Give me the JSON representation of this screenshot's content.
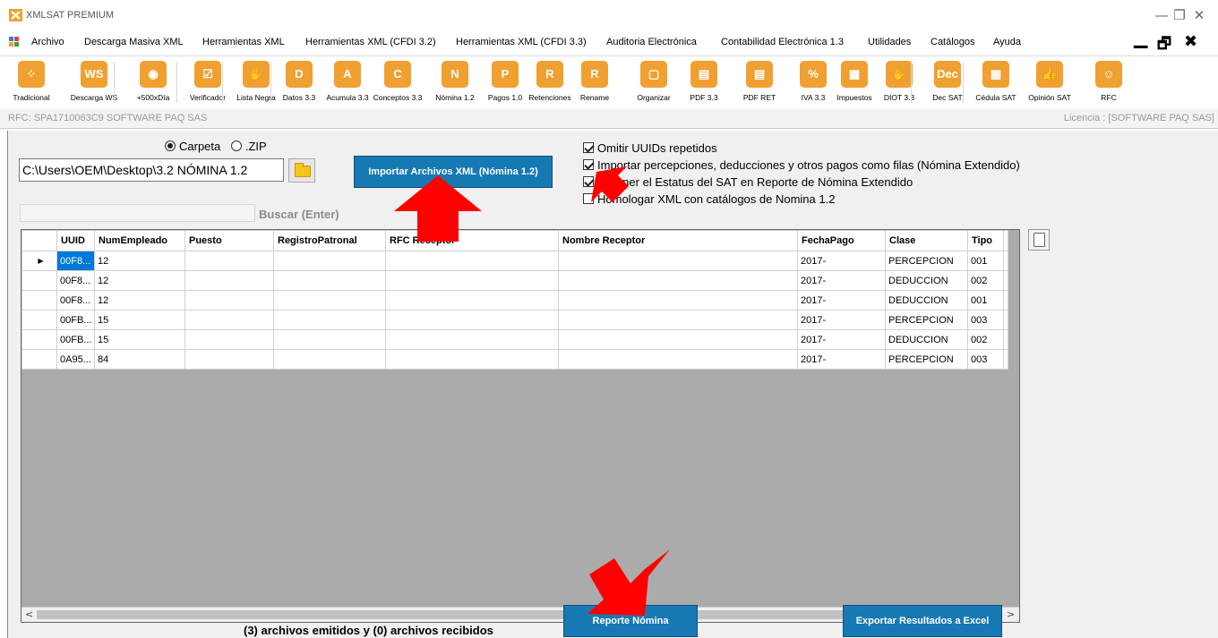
{
  "app": {
    "title": "XMLSAT PREMIUM"
  },
  "window_controls": {
    "minimize": "—",
    "maximize": "❐",
    "close": "✕"
  },
  "menu": {
    "items": [
      "Archivo",
      "Descarga Masiva XML",
      "Herramientas XML",
      "Herramientas XML (CFDI 3.2)",
      "Herramientas XML (CFDI 3.3)",
      "Auditoria Electrónica",
      "Contabilidad Electrónica 1.3",
      "Utilidades",
      "Catálogos",
      "Ayuda"
    ],
    "mdi_minimize": "▁",
    "mdi_restore": "🗗",
    "mdi_close": "✖"
  },
  "toolbar": {
    "tools": [
      {
        "label": "Tradicional",
        "icon": "⁘",
        "color": "#f0a030",
        "name": "tradicional"
      },
      {
        "label": "Descarga WS",
        "icon": "WS",
        "color": "#f0a030",
        "name": "descarga-ws"
      },
      {
        "label": "+500xDía",
        "icon": "◉",
        "color": "#f0a030",
        "name": "500xdia"
      },
      {
        "label": "Verificador",
        "icon": "☑",
        "color": "#f0a030",
        "name": "verificador"
      },
      {
        "label": "Lista Negra",
        "icon": "✋",
        "color": "#f0a030",
        "name": "lista-negra"
      },
      {
        "label": "Datos 3.3",
        "icon": "D",
        "color": "#f0a030",
        "name": "datos-33"
      },
      {
        "label": "Acumula 3.3",
        "icon": "A",
        "color": "#f0a030",
        "name": "acumula-33"
      },
      {
        "label": "Conceptos 3.3",
        "icon": "C",
        "color": "#f0a030",
        "name": "conceptos-33"
      },
      {
        "label": "Nómina 1.2",
        "icon": "N",
        "color": "#f0a030",
        "name": "nomina-12"
      },
      {
        "label": "Pagos 1.0",
        "icon": "P",
        "color": "#f0a030",
        "name": "pagos-10"
      },
      {
        "label": "Retenciones",
        "icon": "R",
        "color": "#f0a030",
        "name": "retenciones"
      },
      {
        "label": "Rename",
        "icon": "R",
        "color": "#f0a030",
        "name": "rename"
      },
      {
        "label": "Organizar",
        "icon": "▢",
        "color": "#f0a030",
        "name": "organizar"
      },
      {
        "label": "PDF 3.3",
        "icon": "▤",
        "color": "#f0a030",
        "name": "pdf-33"
      },
      {
        "label": "PDF RET",
        "icon": "▤",
        "color": "#f0a030",
        "name": "pdf-ret"
      },
      {
        "label": "IVA 3.3",
        "icon": "%",
        "color": "#f0a030",
        "name": "iva-33"
      },
      {
        "label": "Impuestos",
        "icon": "▦",
        "color": "#f0a030",
        "name": "impuestos"
      },
      {
        "label": "DIOT 3.3",
        "icon": "✋",
        "color": "#f0a030",
        "name": "diot-33"
      },
      {
        "label": "Dec SAT",
        "icon": "Dec",
        "color": "#f0a030",
        "name": "dec-sat"
      },
      {
        "label": "Cédula SAT",
        "icon": "▦",
        "color": "#f0a030",
        "name": "cedula-sat"
      },
      {
        "label": "Opinión SAT",
        "icon": "👍",
        "color": "#f0a030",
        "name": "opinion-sat"
      },
      {
        "label": "RFC",
        "icon": "☺",
        "color": "#f0a030",
        "name": "rfc"
      }
    ]
  },
  "rfc_bar": {
    "rfc": "RFC: SPA1710063C9 SOFTWARE PAQ SAS",
    "license": "Licencia : [SOFTWARE PAQ SAS]"
  },
  "source": {
    "option_folder": "Carpeta",
    "option_zip": ".ZIP",
    "selected": "Carpeta"
  },
  "path": {
    "value": "C:\\Users\\OEM\\Desktop\\3.2 NÓMINA 1.2"
  },
  "import_button": "Importar Archivos  XML (Nómina 1.2)",
  "options": [
    {
      "label": "Omitir UUIDs repetidos",
      "checked": true
    },
    {
      "label": "Importar percepciones, deducciones y otros pagos como filas (Nómina Extendido)",
      "checked": true
    },
    {
      "label": "Obtener el Estatus del SAT en Reporte de Nómina Extendido",
      "checked": true
    },
    {
      "label": "Homologar XML con catálogos de Nomina 1.2",
      "checked": false
    }
  ],
  "search": {
    "value": "",
    "label": "Buscar (Enter)"
  },
  "grid": {
    "columns": [
      "UUID",
      "NumEmpleado",
      "Puesto",
      "RegistroPatronal",
      "RFC Receptor",
      "Nombre Receptor",
      "FechaPago",
      "Clase",
      "Tipo"
    ],
    "rows": [
      [
        "00F8...",
        "12",
        "",
        "",
        "",
        "",
        "2017-",
        "PERCEPCION",
        "001"
      ],
      [
        "00F8...",
        "12",
        "",
        "",
        "",
        "",
        "2017-",
        "DEDUCCION",
        "002"
      ],
      [
        "00F8...",
        "12",
        "",
        "",
        "",
        "",
        "2017-",
        "DEDUCCION",
        "001"
      ],
      [
        "00FB...",
        "15",
        "",
        "",
        "",
        "",
        "2017-",
        "PERCEPCION",
        "003"
      ],
      [
        "00FB...",
        "15",
        "",
        "",
        "",
        "",
        "2017-",
        "DEDUCCION",
        "002"
      ],
      [
        "0A95...",
        "84",
        "",
        "",
        "",
        "",
        "2017-",
        "PERCEPCION",
        "003"
      ]
    ],
    "row_indicator": "▶",
    "scroll_left": "<",
    "scroll_right": ">"
  },
  "status": "(3) archivos emitidos y (0) archivos recibidos",
  "report_button": "Reporte Nómina",
  "export_button": "Exportar Resultados  a Excel",
  "colors": {
    "accent_button": "#1779b4",
    "toolbar_icon": "#f0a030",
    "highlight_arrow": "#ff0000",
    "selection": "#0078d7"
  }
}
